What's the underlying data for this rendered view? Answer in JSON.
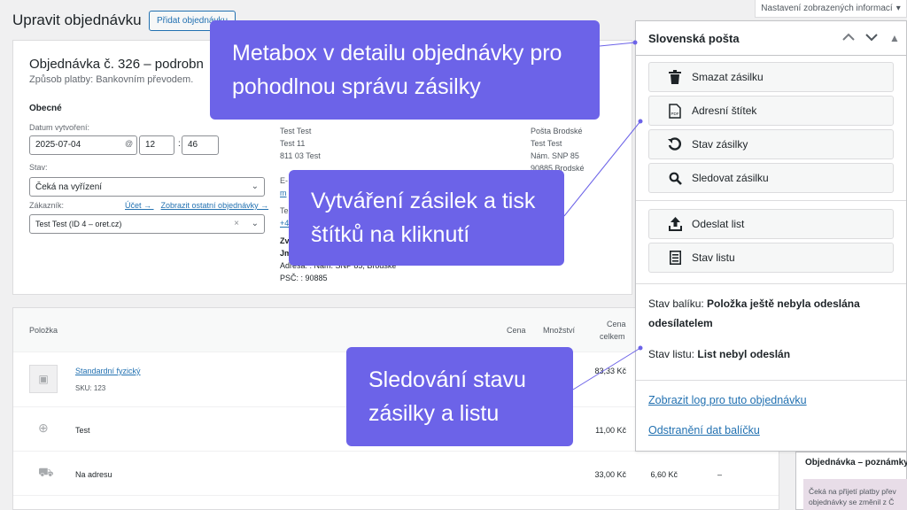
{
  "header": {
    "screen_options": "Nastavení zobrazených informací",
    "page_title": "Upravit objednávku",
    "add_order": "Přidat objednávku"
  },
  "order": {
    "heading": "Objednávka č. 326 – podrobn",
    "payment": "Způsob platby: Bankovním převodem.",
    "general_label": "Obecné",
    "date_label": "Datum vytvoření:",
    "date_value": "2025-07-04",
    "at": "@",
    "hour": "12",
    "minute": "46",
    "status_label": "Stav:",
    "status_value": "Čeká na vyřízení",
    "customer_label": "Zákazník:",
    "customer_link_account": "Účet →",
    "customer_link_orders": "Zobrazit ostatní objednávky →",
    "customer_value": "Test Test (ID 4 –             oret.cz)"
  },
  "billing": {
    "lines": [
      "Test Test",
      "Test 11",
      "811 03 Test"
    ],
    "email_label": "E-",
    "email_link": "m",
    "phone_label": "Te",
    "phone_link": "+4",
    "extra_1": "Zv",
    "extra_2": "Jm",
    "address": "Adresa: : Nám. SNP 85, Brodské",
    "zip": "PSČ: : 90885"
  },
  "shipping": {
    "lines": [
      "Pošta Brodské",
      "Test Test",
      "Nám. SNP 85",
      "90885 Brodské"
    ]
  },
  "items": {
    "headers": {
      "item": "Položka",
      "cost": "Cena",
      "qty": "Množství",
      "total_1": "Cena",
      "total_2": "celkem"
    },
    "product_name": "Standardní fyzický",
    "product_sku": "SKU: 123",
    "product_total": "83,33 Kč",
    "fee_name": "Test",
    "fee_total": "11,00 Kč",
    "shipping_name": "Na adresu",
    "shipping_total": "33,00 Kč",
    "shipping_tax": "6,60 Kč",
    "shipping_dash": "–"
  },
  "metabox": {
    "title": "Slovenská pošta",
    "buttons": {
      "delete": "Smazat zásilku",
      "label": "Adresní štítek",
      "status": "Stav zásilky",
      "track": "Sledovat zásilku",
      "send": "Odeslat list",
      "sheet": "Stav listu"
    },
    "parcel_status_label": "Stav balíku:",
    "parcel_status_value": "Položka ještě nebyla odeslána odesílatelem",
    "sheet_status_label": "Stav listu:",
    "sheet_status_value": "List nebyl odeslán",
    "log_link": "Zobrazit log pro tuto objednávku",
    "remove_link": "Odstranění dat balíčku"
  },
  "notes": {
    "title": "Objednávka – poznámky",
    "body": "Čeká na přijetí platby přev objednávky se změnil z Č"
  },
  "callouts": {
    "c1": "Metabox v detailu objednávky pro pohodlnou správu zásilky",
    "c2": "Vytváření zásilek a tisk štítků na kliknutí",
    "c3": "Sledování stavu zásilky a listu"
  },
  "colors": {
    "accent": "#6c63e8",
    "link": "#2271b1"
  }
}
